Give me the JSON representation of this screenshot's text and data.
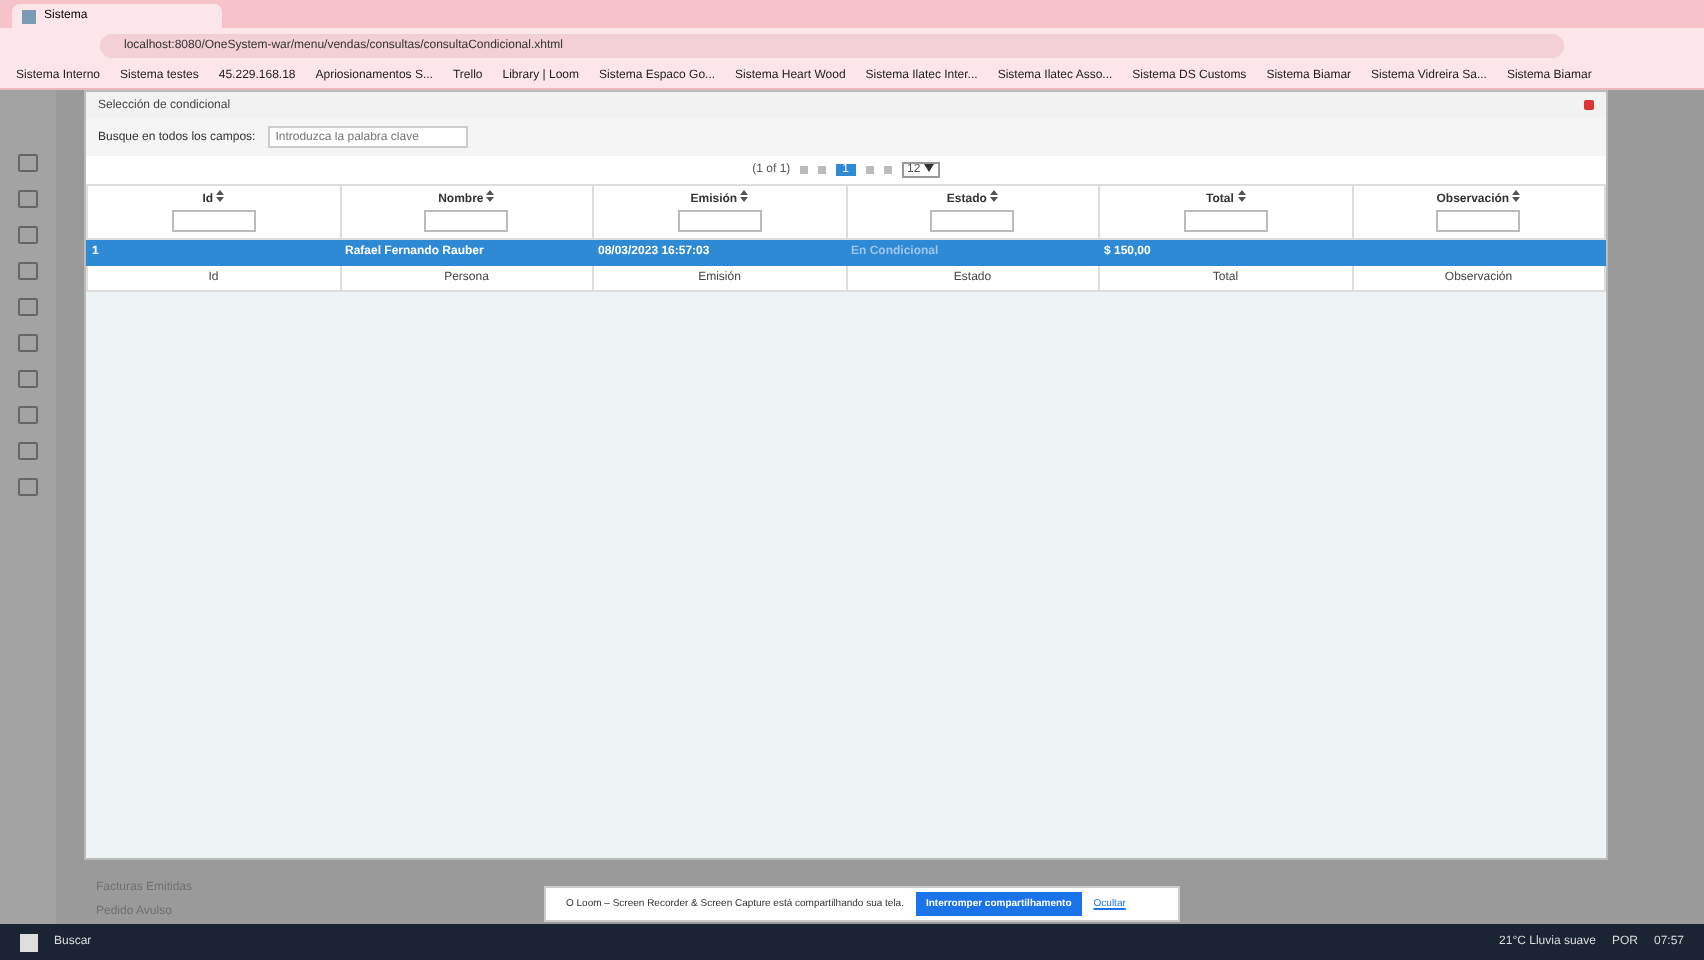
{
  "browser": {
    "tab_title": "Sistema",
    "url": "localhost:8080/OneSystem-war/menu/vendas/consultas/consultaCondicional.xhtml",
    "bookmarks": [
      "Sistema Interno",
      "Sistema testes",
      "45.229.168.18",
      "Apriosionamentos S...",
      "Trello",
      "Library | Loom",
      "Sistema Espaco Go...",
      "Sistema Heart Wood",
      "Sistema Ilatec Inter...",
      "Sistema Ilatec Asso...",
      "Sistema DS Customs",
      "Sistema Biamar",
      "Sistema Vidreira Sa...",
      "Sistema Biamar"
    ]
  },
  "dialog": {
    "title": "Selección de condicional",
    "search_label": "Busque en todos los campos:",
    "search_placeholder": "Introduzca la palabra clave",
    "paginator": {
      "report": "(1 of 1)",
      "page": "1",
      "rows": "12"
    },
    "columns": [
      "Id",
      "Nombre",
      "Emisión",
      "Estado",
      "Total",
      "Observación"
    ],
    "rows": [
      {
        "cells": [
          "1",
          "Rafael Fernando Rauber",
          "08/03/2023 16:57:03",
          "En Condicional",
          "$ 150,00",
          ""
        ],
        "selected": true
      }
    ],
    "footer": [
      "Id",
      "Persona",
      "Emisión",
      "Estado",
      "Total",
      "Observación"
    ]
  },
  "background_links": [
    "Facturas Emitidas",
    "Pedido Avulso"
  ],
  "share_bar": {
    "message": "O Loom – Screen Recorder & Screen Capture está compartilhando sua tela.",
    "stop": "Interromper compartilhamento",
    "hide": "Ocultar"
  },
  "taskbar": {
    "search": "Buscar",
    "weather": "21°C  Lluvia suave",
    "lang": "POR",
    "time": "07:57"
  }
}
